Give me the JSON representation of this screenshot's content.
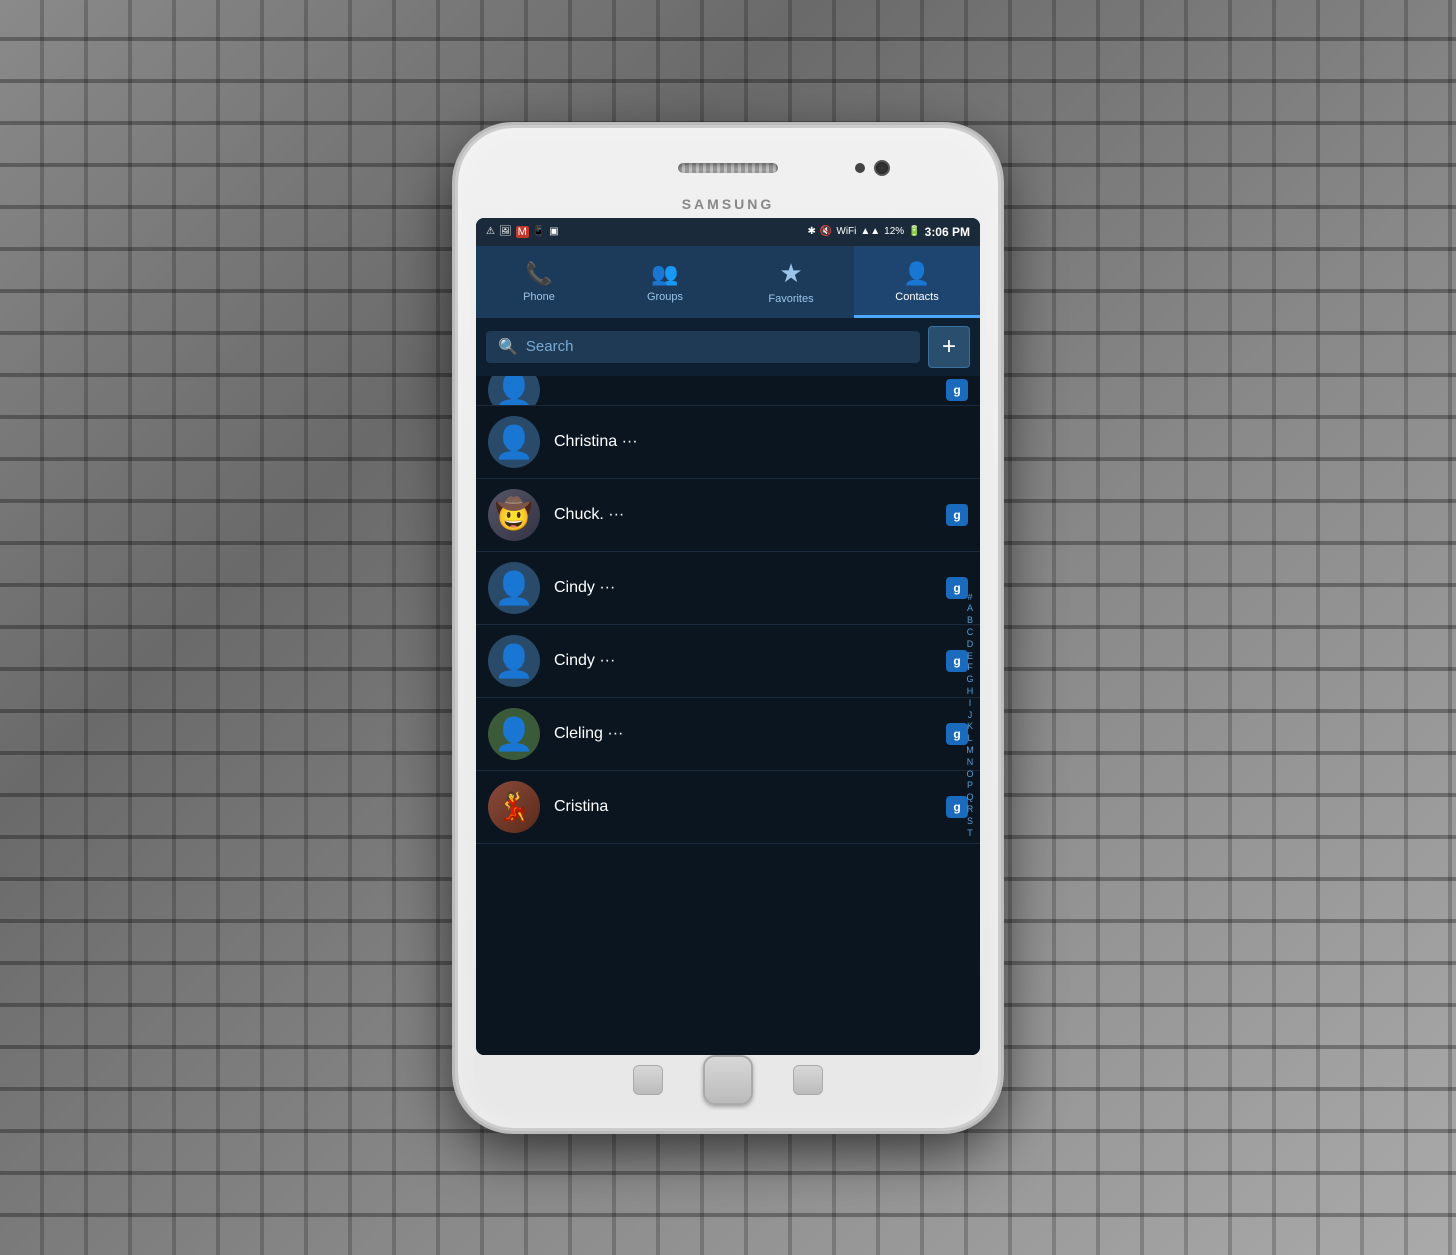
{
  "background": {
    "label": "MacBook Pro keyboard background"
  },
  "phone": {
    "brand": "SAMSUNG",
    "status_bar": {
      "time": "3:06 PM",
      "battery": "12%",
      "icons": [
        "⚠",
        "🖼",
        "M",
        "📱",
        "💾",
        "✱",
        "🔇",
        "📶",
        "📶"
      ]
    },
    "tabs": [
      {
        "id": "phone",
        "label": "Phone",
        "icon": "📞",
        "active": false
      },
      {
        "id": "groups",
        "label": "Groups",
        "icon": "👥",
        "active": false
      },
      {
        "id": "favorites",
        "label": "Favorites",
        "icon": "★",
        "active": false
      },
      {
        "id": "contacts",
        "label": "Contacts",
        "icon": "👤",
        "active": true
      }
    ],
    "search": {
      "placeholder": "Search"
    },
    "add_button_label": "+",
    "contacts": [
      {
        "id": "partial-top",
        "name": "",
        "has_photo": false,
        "badge": "g",
        "partial": true
      },
      {
        "id": "christina",
        "name": "Christina ···",
        "has_photo": false,
        "badge": "",
        "avatar_type": "silhouette"
      },
      {
        "id": "chuck",
        "name": "Chuck. ···",
        "has_photo": true,
        "badge": "g",
        "avatar_type": "photo-chuck"
      },
      {
        "id": "cindy1",
        "name": "Cindy ···",
        "has_photo": false,
        "badge": "g",
        "avatar_type": "silhouette"
      },
      {
        "id": "cindy2",
        "name": "Cindy ···",
        "has_photo": false,
        "badge": "g",
        "avatar_type": "silhouette"
      },
      {
        "id": "cleling",
        "name": "Cleling ···",
        "has_photo": false,
        "badge": "g",
        "avatar_type": "silhouette-green"
      },
      {
        "id": "cristina",
        "name": "Cristina",
        "has_photo": true,
        "badge": "g",
        "avatar_type": "photo-cristina"
      }
    ],
    "alpha_index": [
      "#",
      "A",
      "B",
      "C",
      "D",
      "E",
      "F",
      "G",
      "H",
      "I",
      "J",
      "K",
      "L",
      "M",
      "N",
      "O",
      "P",
      "Q",
      "R",
      "S",
      "T"
    ]
  }
}
